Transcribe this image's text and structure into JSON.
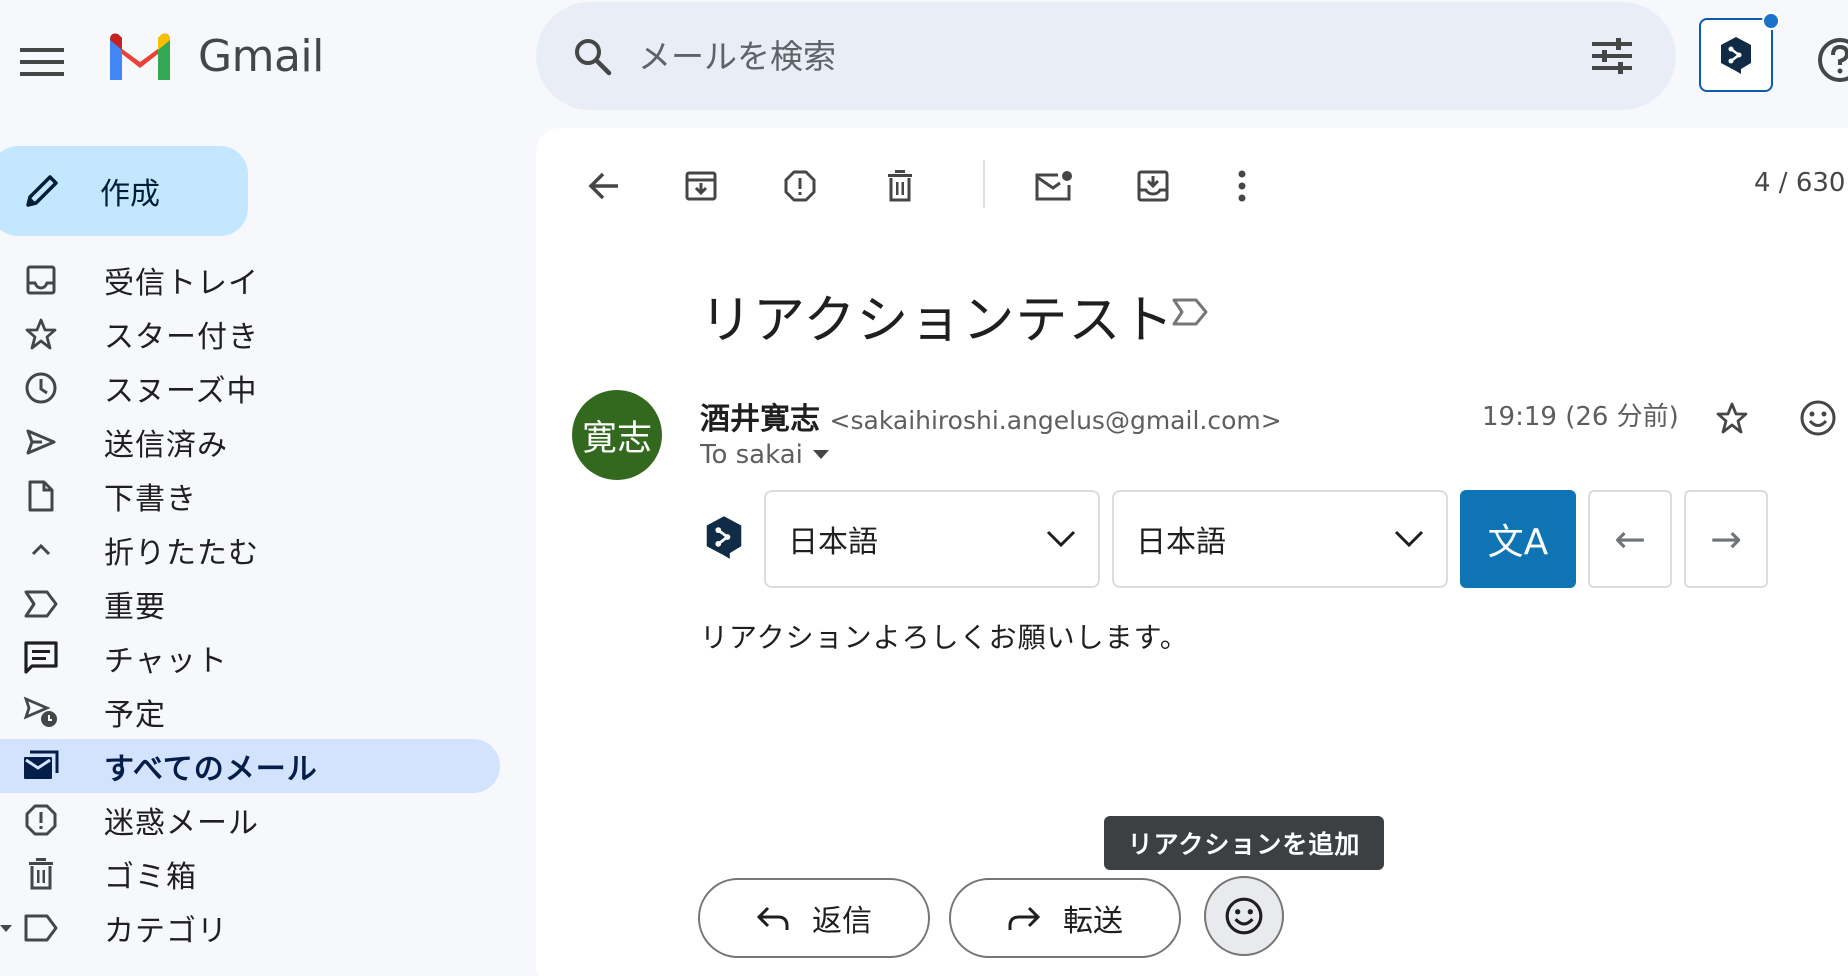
{
  "header": {
    "app_name": "Gmail",
    "search_placeholder": "メールを検索"
  },
  "sidebar": {
    "compose_label": "作成",
    "items": [
      {
        "label": "受信トレイ",
        "icon": "inbox-icon"
      },
      {
        "label": "スター付き",
        "icon": "star-icon"
      },
      {
        "label": "スヌーズ中",
        "icon": "clock-icon"
      },
      {
        "label": "送信済み",
        "icon": "send-icon"
      },
      {
        "label": "下書き",
        "icon": "draft-icon"
      },
      {
        "label": "折りたたむ",
        "icon": "collapse-icon"
      },
      {
        "label": "重要",
        "icon": "important-icon"
      },
      {
        "label": "チャット",
        "icon": "chat-icon"
      },
      {
        "label": "予定",
        "icon": "scheduled-icon"
      },
      {
        "label": "すべてのメール",
        "icon": "all-mail-icon",
        "active": true
      },
      {
        "label": "迷惑メール",
        "icon": "spam-icon"
      },
      {
        "label": "ゴミ箱",
        "icon": "trash-icon"
      },
      {
        "label": "カテゴリ",
        "icon": "label-icon"
      }
    ]
  },
  "toolbar": {
    "counter": "4 / 630"
  },
  "message": {
    "subject": "リアクションテスト",
    "avatar_text": "寛志",
    "avatar_color": "#33691e",
    "sender_name": "酒井寛志",
    "sender_email": "<sakaihiroshi.angelus@gmail.com>",
    "to": "To sakai",
    "time": "19:19 (26 分前)",
    "body": "リアクションよろしくお願いします。"
  },
  "translator": {
    "source_lang": "日本語",
    "target_lang": "日本語",
    "translate_glyph": "文A",
    "back_arrow": "←",
    "forward_arrow": "→",
    "accent": "#0f74b3"
  },
  "actions": {
    "reply_label": "返信",
    "forward_label": "転送",
    "reaction_tooltip": "リアクションを追加"
  }
}
